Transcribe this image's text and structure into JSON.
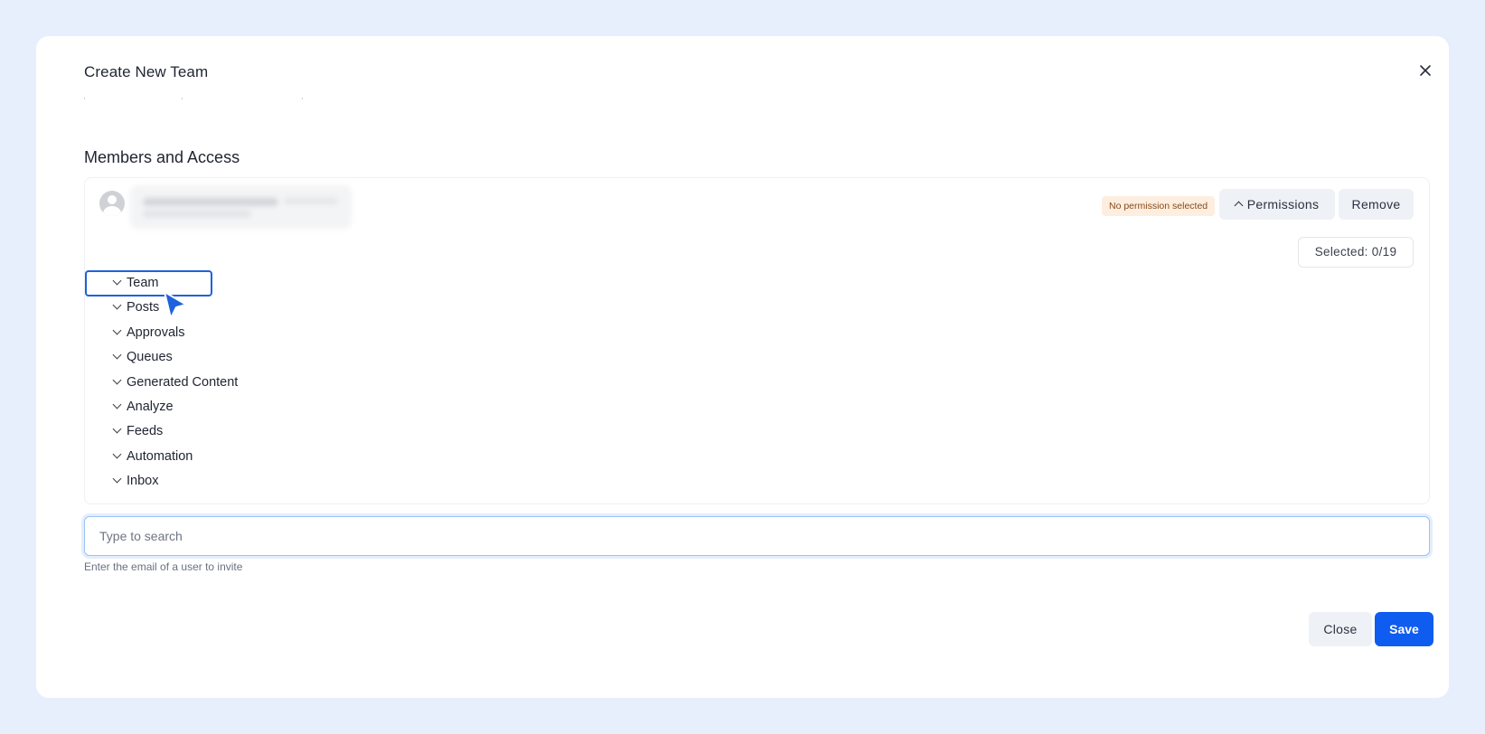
{
  "dialog": {
    "title": "Create New Team",
    "close_icon": "close-icon"
  },
  "members": {
    "section_title": "Members and Access",
    "member": {
      "status_badge": "No permission selected",
      "permissions_label": "Permissions",
      "remove_label": "Remove"
    },
    "selected_count": "Selected: 0/19",
    "permission_groups": [
      {
        "label": "Team"
      },
      {
        "label": "Posts"
      },
      {
        "label": "Approvals"
      },
      {
        "label": "Queues"
      },
      {
        "label": "Generated Content"
      },
      {
        "label": "Analyze"
      },
      {
        "label": "Feeds"
      },
      {
        "label": "Automation"
      },
      {
        "label": "Inbox"
      }
    ]
  },
  "search": {
    "placeholder": "Type to search",
    "value": "",
    "helper": "Enter the email of a user to invite"
  },
  "footer": {
    "close_label": "Close",
    "save_label": "Save"
  },
  "colors": {
    "accent": "#0f5cf0",
    "focus": "#1d63dc",
    "badge_bg": "#fdeee0",
    "badge_text": "#8a4a16"
  }
}
